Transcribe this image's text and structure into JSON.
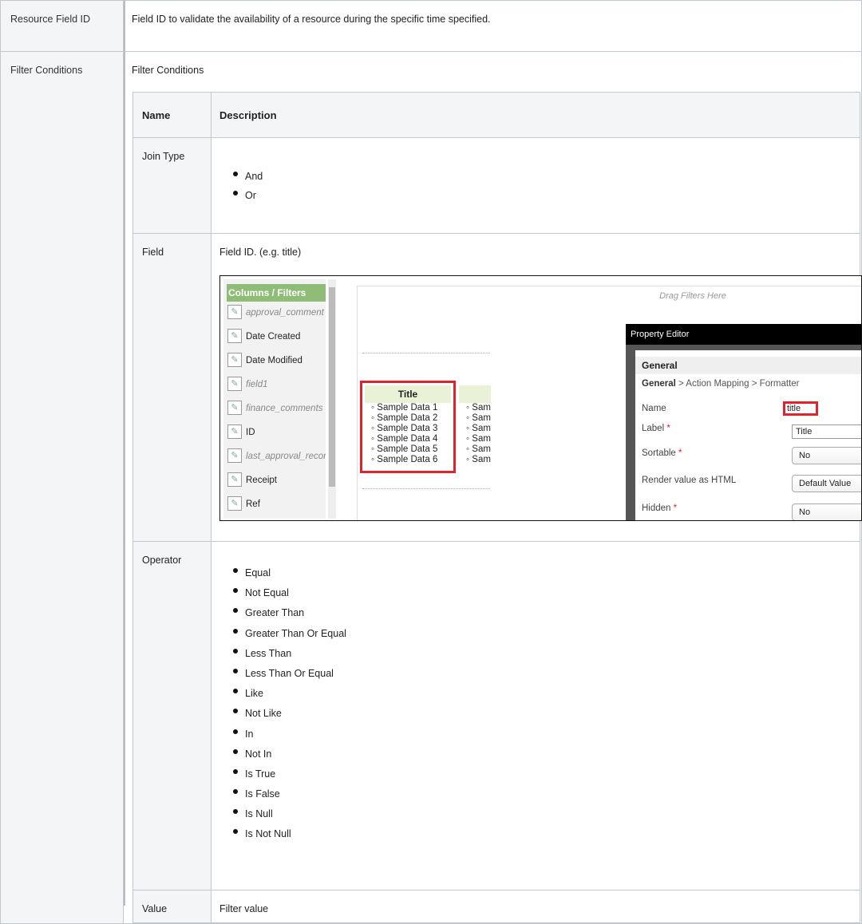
{
  "rows": {
    "resource_field_id": {
      "label": "Resource Field ID",
      "description": "Field ID to validate the availability of a resource during the specific time specified."
    },
    "filter_conditions": {
      "label": "Filter Conditions",
      "title": "Filter Conditions"
    }
  },
  "inner_table": {
    "header_name": "Name",
    "header_description": "Description",
    "join_type": {
      "label": "Join Type",
      "options": [
        "And",
        "Or"
      ]
    },
    "field": {
      "label": "Field",
      "description": "Field ID. (e.g. title)"
    },
    "operator": {
      "label": "Operator",
      "options": [
        "Equal",
        "Not Equal",
        "Greater Than",
        "Greater Than Or Equal",
        "Less Than",
        "Less Than Or Equal",
        "Like",
        "Not Like",
        "In",
        "Not In",
        "Is True",
        "Is False",
        "Is Null",
        "Is Not Null"
      ]
    },
    "value": {
      "label": "Value",
      "description": "Filter value"
    }
  },
  "screenshot": {
    "columns_header": "Columns / Filters",
    "columns": [
      {
        "name": "approval_comment",
        "italic": true
      },
      {
        "name": "Date Created",
        "italic": false
      },
      {
        "name": "Date Modified",
        "italic": false
      },
      {
        "name": "field1",
        "italic": true
      },
      {
        "name": "finance_comments",
        "italic": true
      },
      {
        "name": "ID",
        "italic": false
      },
      {
        "name": "last_approval_record",
        "italic": true
      },
      {
        "name": "Receipt",
        "italic": false
      },
      {
        "name": "Ref",
        "italic": false
      }
    ],
    "drag_filters": "Drag Filters Here",
    "title_column": "Title",
    "sample_rows": [
      "Sample Data 1",
      "Sample Data 2",
      "Sample Data 3",
      "Sample Data 4",
      "Sample Data 5",
      "Sample Data 6"
    ],
    "second_col_rows": [
      "Sam",
      "Sam",
      "Sam",
      "Sam",
      "Sam",
      "Sam"
    ],
    "property_editor": {
      "title": "Property Editor",
      "section": "General",
      "breadcrumb_bold": "General",
      "breadcrumb_rest": " > Action Mapping > Formatter",
      "name_label": "Name",
      "name_value": "title",
      "label_label": "Label",
      "label_value": "Title",
      "sortable_label": "Sortable",
      "sortable_value": "No",
      "render_label": "Render value as HTML",
      "render_value": "Default Value",
      "hidden_label": "Hidden",
      "hidden_value": "No",
      "required_mark": "*"
    },
    "accent_red": "#e0222d",
    "header_green": "#8fbd78"
  }
}
